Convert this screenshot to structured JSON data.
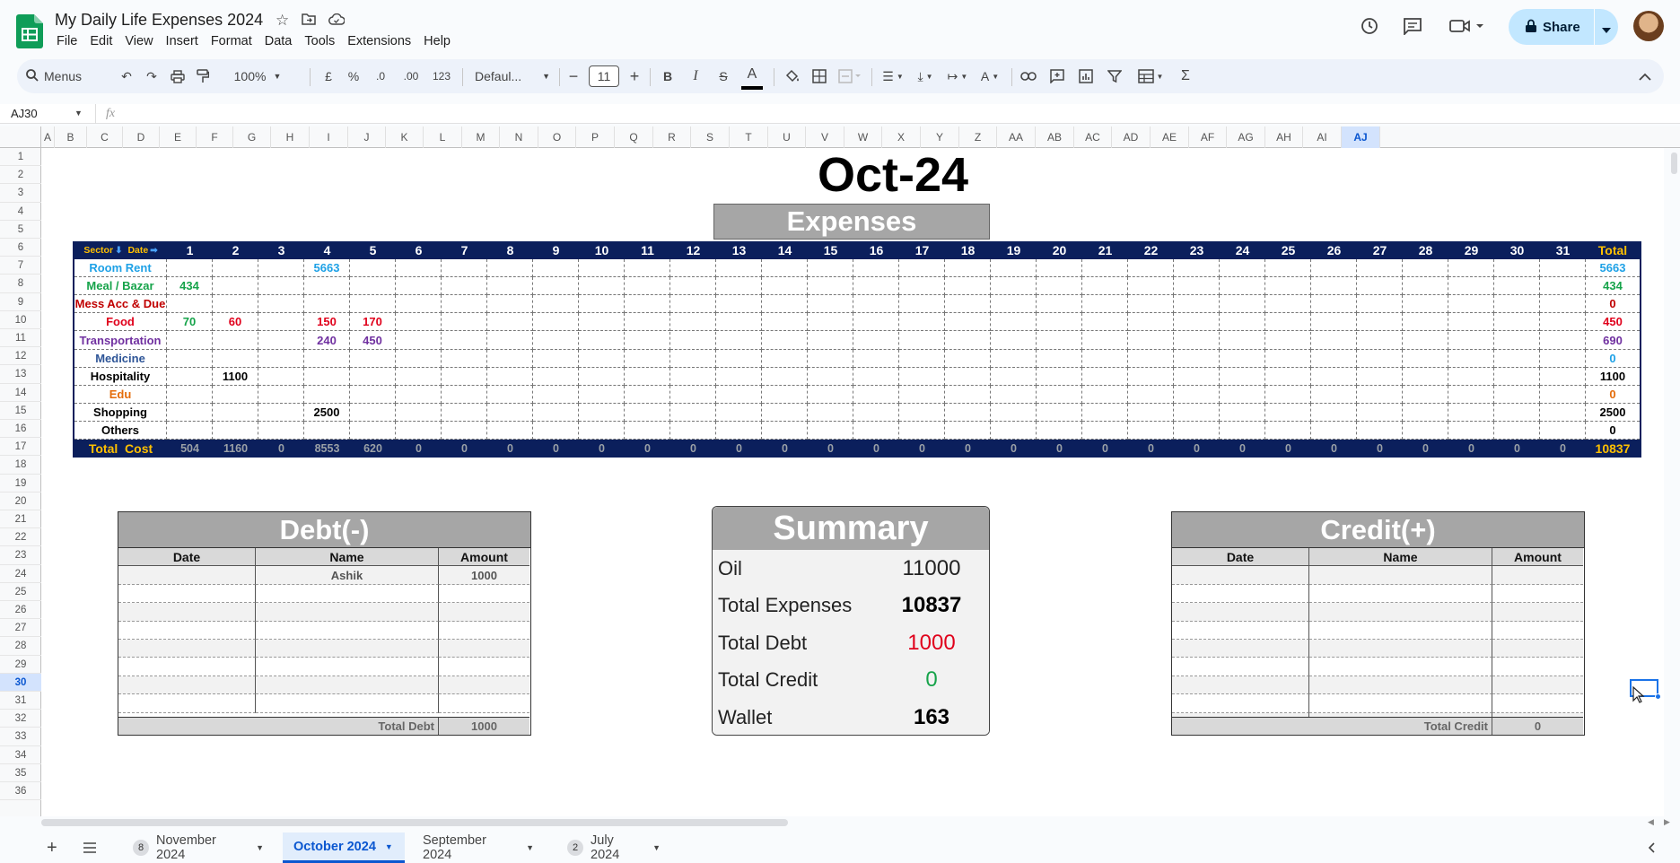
{
  "app": {
    "doc_title": "My Daily Life Expenses 2024",
    "menu": [
      "File",
      "Edit",
      "View",
      "Insert",
      "Format",
      "Data",
      "Tools",
      "Extensions",
      "Help"
    ],
    "share_label": "Share"
  },
  "toolbar": {
    "search_label": "Menus",
    "zoom": "100%",
    "currency": "£",
    "percent": "%",
    "dec_decrease": ".0",
    "dec_increase": ".00",
    "number_format": "123",
    "font": "Defaul...",
    "font_size": "11",
    "bold": "B",
    "italic": "I",
    "strike": "S",
    "text_color": "A",
    "sum": "Σ"
  },
  "formula_bar": {
    "name_box": "AJ30",
    "fx": "fx",
    "value": ""
  },
  "columns": [
    "A",
    "B",
    "C",
    "D",
    "E",
    "F",
    "G",
    "H",
    "I",
    "J",
    "K",
    "L",
    "M",
    "N",
    "O",
    "P",
    "Q",
    "R",
    "S",
    "T",
    "U",
    "V",
    "W",
    "X",
    "Y",
    "Z",
    "AA",
    "AB",
    "AC",
    "AD",
    "AE",
    "AF",
    "AG",
    "AH",
    "AI",
    "AJ"
  ],
  "rows": [
    "1",
    "2",
    "3",
    "4",
    "5",
    "6",
    "7",
    "8",
    "9",
    "10",
    "11",
    "12",
    "13",
    "14",
    "15",
    "16",
    "17",
    "18",
    "19",
    "20",
    "21",
    "22",
    "23",
    "24",
    "25",
    "26",
    "27",
    "28",
    "29",
    "30",
    "31",
    "32",
    "33",
    "34",
    "35",
    "36"
  ],
  "sheet": {
    "month_title": "Oct-24",
    "expenses_title": "Expenses",
    "header": {
      "sector": "Sector",
      "date": "Date",
      "days": [
        "1",
        "2",
        "3",
        "4",
        "5",
        "6",
        "7",
        "8",
        "9",
        "10",
        "11",
        "12",
        "13",
        "14",
        "15",
        "16",
        "17",
        "18",
        "19",
        "20",
        "21",
        "22",
        "23",
        "24",
        "25",
        "26",
        "27",
        "28",
        "29",
        "30",
        "31"
      ],
      "total": "Total"
    },
    "categories": [
      {
        "name": "Room Rent",
        "color": "#1ea1e6",
        "values": {
          "4": "5663"
        },
        "total": "5663"
      },
      {
        "name": "Meal / Bazar",
        "color": "#16a34a",
        "values": {
          "1": "434"
        },
        "total": "434"
      },
      {
        "name": "Mess Acc & Due",
        "color": "#c00000",
        "values": {},
        "total": "0"
      },
      {
        "name": "Food",
        "color": "#e0001b",
        "values": {
          "1": "70",
          "2": "60",
          "4": "150",
          "5": "170"
        },
        "total": "450",
        "day_colors": {
          "1": "#16a34a"
        }
      },
      {
        "name": "Transportation",
        "color": "#7030a0",
        "values": {
          "4": "240",
          "5": "450"
        },
        "total": "690"
      },
      {
        "name": "Medicine",
        "color": "#2e5597",
        "values": {},
        "total": "0",
        "total_color": "#1ea1e6"
      },
      {
        "name": "Hospitality",
        "color": "#000000",
        "values": {
          "2": "1100"
        },
        "total": "1100"
      },
      {
        "name": "Edu",
        "color": "#e46c0a",
        "values": {},
        "total": "0"
      },
      {
        "name": "Shopping",
        "color": "#000000",
        "values": {
          "4": "2500"
        },
        "total": "2500"
      },
      {
        "name": "Others",
        "color": "#000000",
        "values": {},
        "total": "0"
      }
    ],
    "total_row": {
      "label": "Total  Cost",
      "values": [
        "504",
        "1160",
        "0",
        "8553",
        "620",
        "0",
        "0",
        "0",
        "0",
        "0",
        "0",
        "0",
        "0",
        "0",
        "0",
        "0",
        "0",
        "0",
        "0",
        "0",
        "0",
        "0",
        "0",
        "0",
        "0",
        "0",
        "0",
        "0",
        "0",
        "0",
        "0"
      ],
      "total": "10837"
    },
    "debt": {
      "title": "Debt(-)",
      "cols": [
        "Date",
        "Name",
        "Amount"
      ],
      "rows": [
        [
          "",
          "Ashik",
          "1000"
        ],
        [
          "",
          "",
          ""
        ],
        [
          "",
          "",
          ""
        ],
        [
          "",
          "",
          ""
        ],
        [
          "",
          "",
          ""
        ],
        [
          "",
          "",
          ""
        ],
        [
          "",
          "",
          ""
        ],
        [
          "",
          "",
          ""
        ]
      ],
      "footer_label": "Total Debt",
      "footer_value": "1000"
    },
    "summary": {
      "title": "Summary",
      "items": [
        {
          "label": "Oil",
          "value": "11000",
          "color": "#222222",
          "bold": false
        },
        {
          "label": "Total Expenses",
          "value": "10837",
          "color": "#000000",
          "bold": true
        },
        {
          "label": "Total Debt",
          "value": "1000",
          "color": "#e0001b",
          "bold": false
        },
        {
          "label": "Total Credit",
          "value": "0",
          "color": "#16a34a",
          "bold": false
        },
        {
          "label": "Wallet",
          "value": "163",
          "color": "#000000",
          "bold": true
        }
      ]
    },
    "credit": {
      "title": "Credit(+)",
      "cols": [
        "Date",
        "Name",
        "Amount"
      ],
      "rows": [
        [
          "",
          "",
          ""
        ],
        [
          "",
          "",
          ""
        ],
        [
          "",
          "",
          ""
        ],
        [
          "",
          "",
          ""
        ],
        [
          "",
          "",
          ""
        ],
        [
          "",
          "",
          ""
        ],
        [
          "",
          "",
          ""
        ],
        [
          "",
          "",
          ""
        ],
        [
          "",
          "",
          ""
        ]
      ],
      "footer_label": "Total Credit",
      "footer_value": "0"
    }
  },
  "tabs": [
    {
      "label": "November 2024",
      "badge": "8",
      "active": false
    },
    {
      "label": "October 2024",
      "badge": "",
      "active": true
    },
    {
      "label": "September 2024",
      "badge": "",
      "active": false
    },
    {
      "label": "July 2024",
      "badge": "2",
      "active": false
    }
  ],
  "colors": {
    "navy": "#0b1f5c",
    "gold": "#ffc000",
    "gray_header": "#a6a6a6",
    "active_tab": "#e1edfc",
    "accent": "#0b57d0"
  }
}
